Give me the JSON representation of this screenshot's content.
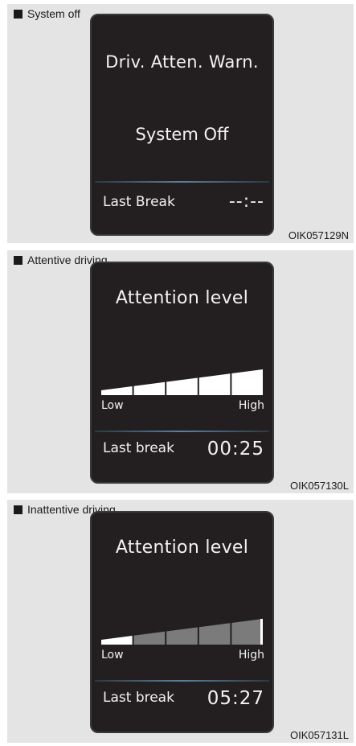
{
  "figures": [
    {
      "heading": "System off",
      "title": "Driv. Atten. Warn.",
      "status": "System Off",
      "break_label": "Last Break",
      "break_value": "--:--",
      "code": "OIK057129N"
    },
    {
      "heading": "Attentive driving",
      "title": "Attention level",
      "low_label": "Low",
      "high_label": "High",
      "attention_level": 1.0,
      "break_label": "Last break",
      "break_value": "00:25",
      "code": "OIK057130L"
    },
    {
      "heading": "Inattentive driving",
      "title": "Attention level",
      "low_label": "Low",
      "high_label": "High",
      "attention_level": 0.2,
      "break_label": "Last break",
      "break_value": "05:27",
      "code": "OIK057131L"
    }
  ],
  "colors": {
    "panel_background": "#e4e4e4",
    "screen_background": "#231f20",
    "bar_active": "#ffffff",
    "bar_inactive": "#7b7b7b",
    "divider_accent": "#5b7f99"
  }
}
